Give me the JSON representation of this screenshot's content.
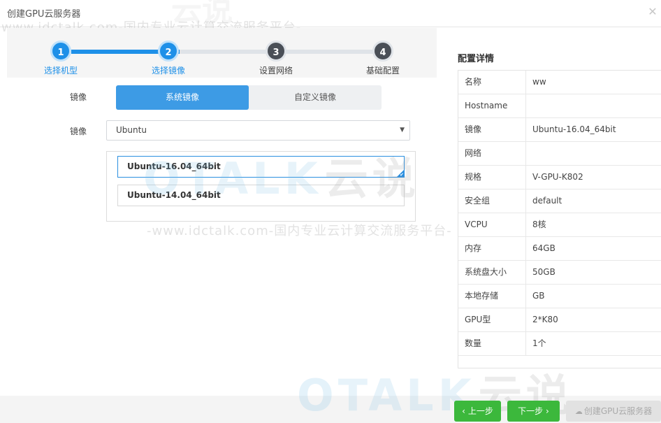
{
  "window": {
    "title": "创建GPU云服务器"
  },
  "watermark": {
    "site_text": "www.idctalk.com-国内专业云计算交流服务平台-",
    "site_text_mid": "-www.idctalk.com-国内专业云计算交流服务平台-",
    "brand": "TALK",
    "brand_cn": "云说"
  },
  "steps": [
    {
      "number": "1",
      "label": "选择机型",
      "state": "done"
    },
    {
      "number": "2",
      "label": "选择镜像",
      "state": "current"
    },
    {
      "number": "3",
      "label": "设置网络",
      "state": "todo"
    },
    {
      "number": "4",
      "label": "基础配置",
      "state": "todo"
    }
  ],
  "form": {
    "image_type_label": "镜像",
    "image_type_options": [
      "系统镜像",
      "自定义镜像"
    ],
    "image_type_selected": "系统镜像",
    "os_label": "镜像",
    "os_value": "Ubuntu",
    "image_list": [
      {
        "name": "Ubuntu-16.04_64bit",
        "selected": true
      },
      {
        "name": "Ubuntu-14.04_64bit",
        "selected": false
      }
    ]
  },
  "details": {
    "title": "配置详情",
    "rows": [
      {
        "key": "名称",
        "value": "ww"
      },
      {
        "key": "Hostname",
        "value": ""
      },
      {
        "key": "镜像",
        "value": "Ubuntu-16.04_64bit"
      },
      {
        "key": "网络",
        "value": ""
      },
      {
        "key": "规格",
        "value": "V-GPU-K802"
      },
      {
        "key": "安全组",
        "value": "default"
      },
      {
        "key": "VCPU",
        "value": "8核"
      },
      {
        "key": "内存",
        "value": "64GB"
      },
      {
        "key": "系统盘大小",
        "value": "50GB"
      },
      {
        "key": "本地存储",
        "value": "GB"
      },
      {
        "key": "GPU型",
        "value": "2*K80"
      },
      {
        "key": "数量",
        "value": "1个"
      }
    ]
  },
  "footer": {
    "prev_label": "上一步",
    "next_label": "下一步",
    "create_label": "创建GPU云服务器"
  },
  "colors": {
    "accent": "#1e90e8",
    "success": "#3cb83c",
    "step_todo": "#4a4f57"
  },
  "icons": {
    "close": "close-icon",
    "dropdown": "chevron-down-icon",
    "check": "check-icon",
    "prev": "chevron-left-icon",
    "next": "chevron-right-icon",
    "cloud": "cloud-icon"
  }
}
